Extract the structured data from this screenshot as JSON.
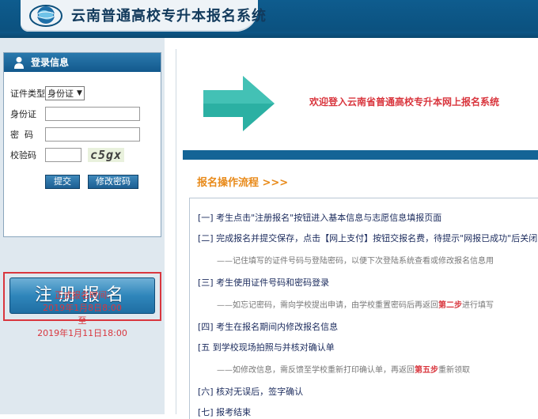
{
  "header": {
    "title": "云南普通高校专升本报名系统",
    "globe_icon": "globe-icon"
  },
  "login": {
    "title": "登录信息",
    "id_type_label": "证件类型",
    "id_type_selected": "身份证",
    "id_number_label": "身份证",
    "password_label": "密  码",
    "captcha_label": "校验码",
    "captcha_text": "c5gx",
    "submit_label": "提交",
    "change_password_label": "修改密码"
  },
  "register": {
    "button_label": "注册报名",
    "time_title": "正式报名时间:",
    "start": "2019年1月8日8:00",
    "to": "至",
    "end": "2019年1月11日18:00"
  },
  "main": {
    "welcome": "欢迎登入云南省普通高校专升本网上报名系统",
    "flow_title": "报名操作流程 >>>",
    "steps": [
      "[一] 考生点击\"注册报名\"按钮进入基本信息与志愿信息填报页面",
      "[二] 完成报名并提交保存，点击【网上支付】按钮交报名费，待提示\"网报已成功\"后关闭页面",
      "[三] 考生使用证件号码和密码登录",
      "[四] 考生在报名期间内修改报名信息",
      "[五 到学校现场拍照与并核对确认单",
      "[六] 核对无误后，签字确认",
      "[七] 报考结束"
    ],
    "note1": "——记住填写的证件号码与登陆密码，以便下次登陆系统查看或修改报名信息用",
    "note3_prefix": "——如忘记密码，需向学校提出申请，由学校重置密码后再返回",
    "note3_highlight": "第二步",
    "note3_suffix": "进行填写",
    "note5_prefix": "——如修改信息，需反馈至学校重新打印确认单，再返回",
    "note5_highlight": "第五步",
    "note5_suffix": "重新领取"
  },
  "colors": {
    "header_blue": "#0e5c8e",
    "accent_red": "#d9363e",
    "flow_orange": "#e88a1a",
    "arrow_teal": "#2bb0a3"
  }
}
